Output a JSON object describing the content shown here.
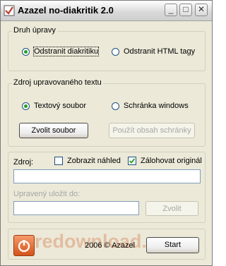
{
  "window": {
    "title": "Azazel no-diakritik 2.0",
    "minimize_glyph": "_",
    "maximize_glyph": "□",
    "close_glyph": "✕"
  },
  "mode_group": {
    "legend": "Druh úpravy",
    "options": [
      {
        "label": "Odstranit diakritiku",
        "selected": true
      },
      {
        "label": "Odstranit HTML tagy",
        "selected": false
      }
    ]
  },
  "source_group": {
    "legend": "Zdroj upravovaného textu",
    "options": [
      {
        "label": "Textový soubor",
        "selected": true
      },
      {
        "label": "Schránka windows",
        "selected": false
      }
    ],
    "choose_file_label": "Zvolit soubor",
    "use_clipboard_label": "Použít obsah schránky"
  },
  "files": {
    "source_label": "Zdroj:",
    "preview_label": "Zobrazit náhled",
    "preview_checked": false,
    "backup_label": "Zálohovat originál",
    "backup_checked": true,
    "source_value": "",
    "save_label": "Upravený uložit do:",
    "save_value": "",
    "choose_label": "Zvolit"
  },
  "footer": {
    "copyright": "2006 © Azazel",
    "start_label": "Start",
    "watermark": "redownload.com"
  }
}
